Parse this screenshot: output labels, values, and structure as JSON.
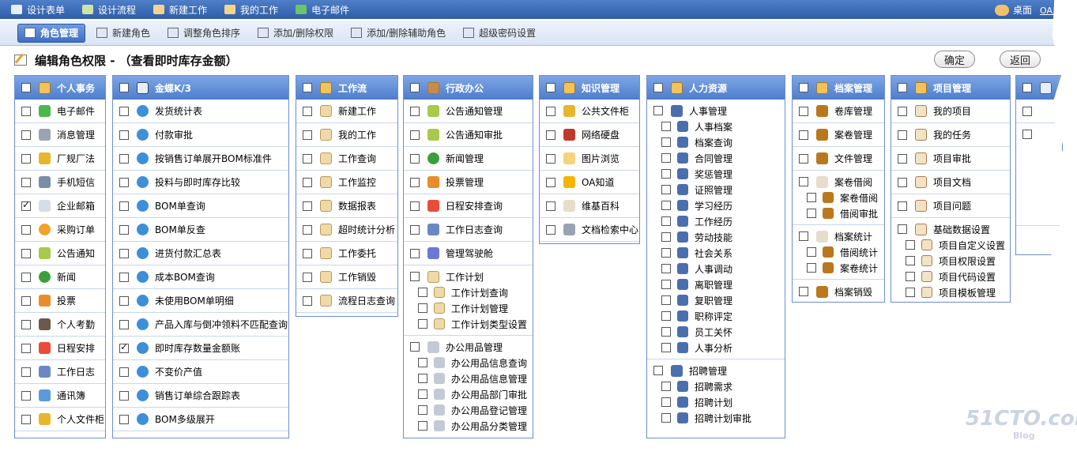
{
  "topnav": {
    "items": [
      "设计表单",
      "设计流程",
      "新建工作",
      "我的工作",
      "电子邮件"
    ],
    "desktop": "桌面",
    "user": "OA主"
  },
  "tabs": [
    "角色管理",
    "新建角色",
    "调整角色排序",
    "添加/删除权限",
    "添加/删除辅助角色",
    "超级密码设置"
  ],
  "page": {
    "title": "编辑角色权限 - （查看即时库存金额）",
    "confirm": "确定",
    "back": "返回"
  },
  "panels": {
    "personal": {
      "title": "个人事务",
      "items": [
        {
          "label": "电子邮件",
          "checked": false,
          "icon": "c-mail"
        },
        {
          "label": "消息管理",
          "checked": false,
          "icon": "c-msg"
        },
        {
          "label": "厂规厂法",
          "checked": false,
          "icon": "c-folder"
        },
        {
          "label": "手机短信",
          "checked": false,
          "icon": "c-phone"
        },
        {
          "label": "企业邮箱",
          "checked": true,
          "icon": "c-pc"
        },
        {
          "label": "采购订单",
          "checked": false,
          "icon": "c-buy"
        },
        {
          "label": "公告通知",
          "checked": false,
          "icon": "c-notice"
        },
        {
          "label": "新闻",
          "checked": false,
          "icon": "c-star"
        },
        {
          "label": "投票",
          "checked": false,
          "icon": "c-vote"
        },
        {
          "label": "个人考勤",
          "checked": false,
          "icon": "c-person"
        },
        {
          "label": "日程安排",
          "checked": false,
          "icon": "c-cal"
        },
        {
          "label": "工作日志",
          "checked": false,
          "icon": "c-log"
        },
        {
          "label": "通讯簿",
          "checked": false,
          "icon": "c-card"
        },
        {
          "label": "个人文件柜",
          "checked": false,
          "icon": "c-folder"
        }
      ]
    },
    "kingdee": {
      "title": "金蝶K/3",
      "items": [
        {
          "label": "发货统计表",
          "checked": false
        },
        {
          "label": "付款审批",
          "checked": false
        },
        {
          "label": "按销售订单展开BOM标准件",
          "checked": false
        },
        {
          "label": "投料与即时库存比较",
          "checked": false
        },
        {
          "label": "BOM单查询",
          "checked": false
        },
        {
          "label": "BOM单反查",
          "checked": false
        },
        {
          "label": "进货付款汇总表",
          "checked": false
        },
        {
          "label": "成本BOM查询",
          "checked": false
        },
        {
          "label": "未使用BOM单明细",
          "checked": false
        },
        {
          "label": "产品入库与倒冲领料不匹配查询",
          "checked": false
        },
        {
          "label": "即时库存数量金额账",
          "checked": true
        },
        {
          "label": "不变价产值",
          "checked": false
        },
        {
          "label": "销售订单综合跟踪表",
          "checked": false
        },
        {
          "label": "BOM多级展开",
          "checked": false
        }
      ]
    },
    "workflow": {
      "title": "工作流",
      "items": [
        "新建工作",
        "我的工作",
        "工作查询",
        "工作监控",
        "数据报表",
        "超时统计分析",
        "工作委托",
        "工作销毁",
        "流程日志查询"
      ]
    },
    "admin": {
      "title": "行政办公",
      "items": [
        {
          "label": "公告通知管理",
          "icon": "c-notice"
        },
        {
          "label": "公告通知审批",
          "icon": "c-notice"
        },
        {
          "label": "新闻管理",
          "icon": "c-star"
        },
        {
          "label": "投票管理",
          "icon": "c-vote"
        },
        {
          "label": "日程安排查询",
          "icon": "c-cal"
        },
        {
          "label": "工作日志查询",
          "icon": "c-log"
        },
        {
          "label": "管理驾驶舱",
          "icon": "c-chart"
        }
      ],
      "plan": {
        "label": "工作计划",
        "subs": [
          "工作计划查询",
          "工作计划管理",
          "工作计划类型设置"
        ]
      },
      "supplies": {
        "label": "办公用品管理",
        "subs": [
          "办公用品信息查询",
          "办公用品信息管理",
          "办公用品部门审批",
          "办公用品登记管理",
          "办公用品分类管理"
        ]
      }
    },
    "knowledge": {
      "title": "知识管理",
      "items": [
        {
          "label": "公共文件柜",
          "icon": "c-folder"
        },
        {
          "label": "网络硬盘",
          "icon": "c-disk"
        },
        {
          "label": "图片浏览",
          "icon": "c-img"
        },
        {
          "label": "OA知道",
          "icon": "c-help"
        },
        {
          "label": "维基百科",
          "icon": "c-book"
        },
        {
          "label": "文档检索中心",
          "icon": "c-msg"
        }
      ]
    },
    "hr": {
      "title": "人力资源",
      "manage": {
        "label": "人事管理",
        "subs": [
          "人事档案",
          "档案查询",
          "合同管理",
          "奖惩管理",
          "证照管理",
          "学习经历",
          "工作经历",
          "劳动技能",
          "社会关系",
          "人事调动",
          "离职管理",
          "复职管理",
          "职称评定",
          "员工关怀",
          "人事分析"
        ]
      },
      "recruit": {
        "label": "招聘管理",
        "subs": [
          "招聘需求",
          "招聘计划",
          "招聘计划审批"
        ]
      }
    },
    "archive": {
      "title": "档案管理",
      "items": [
        "卷库管理",
        "案卷管理",
        "文件管理"
      ],
      "borrow": {
        "label": "案卷借阅",
        "subs": [
          "案卷借阅",
          "借阅审批"
        ]
      },
      "stats": {
        "label": "档案统计",
        "subs": [
          "借阅统计",
          "案卷统计"
        ]
      },
      "destroy": "档案销毁"
    },
    "project": {
      "title": "项目管理",
      "items": [
        "我的项目",
        "我的任务",
        "项目审批",
        "项目文档",
        "项目问题"
      ],
      "base": {
        "label": "基础数据设置",
        "subs": [
          "项目自定义设置",
          "项目权限设置",
          "项目代码设置",
          "项目模板管理"
        ]
      }
    }
  },
  "watermark": {
    "main": "51CTO.com",
    "sub": "Blog"
  }
}
